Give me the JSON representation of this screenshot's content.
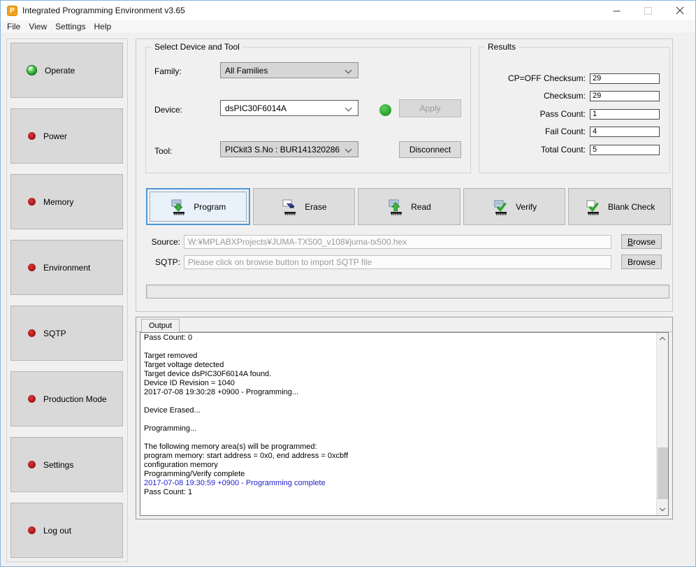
{
  "window": {
    "title": "Integrated Programming Environment v3.65"
  },
  "menu": {
    "items": [
      {
        "label": "File"
      },
      {
        "label": "View"
      },
      {
        "label": "Settings"
      },
      {
        "label": "Help"
      }
    ]
  },
  "sidebar": {
    "items": [
      {
        "label": "Operate",
        "status": "active"
      },
      {
        "label": "Power",
        "status": "inactive"
      },
      {
        "label": "Memory",
        "status": "inactive"
      },
      {
        "label": "Environment",
        "status": "inactive"
      },
      {
        "label": "SQTP",
        "status": "inactive"
      },
      {
        "label": "Production Mode",
        "status": "inactive"
      },
      {
        "label": "Settings",
        "status": "inactive"
      },
      {
        "label": "Log out",
        "status": "inactive"
      }
    ]
  },
  "device_tool": {
    "group_title": "Select Device and Tool",
    "family_label": "Family:",
    "family_value": "All Families",
    "device_label": "Device:",
    "device_value": "dsPIC30F6014A",
    "tool_label": "Tool:",
    "tool_value": "PICkit3 S.No : BUR141320286",
    "apply_label": "Apply",
    "disconnect_label": "Disconnect"
  },
  "results": {
    "group_title": "Results",
    "rows": [
      {
        "label": "CP=OFF Checksum:",
        "value": "29"
      },
      {
        "label": "Checksum:",
        "value": "29"
      },
      {
        "label": "Pass Count:",
        "value": "1"
      },
      {
        "label": "Fail Count:",
        "value": "4"
      },
      {
        "label": "Total Count:",
        "value": "5"
      }
    ]
  },
  "actions": {
    "buttons": [
      {
        "label": "Program",
        "icon": "program-icon",
        "selected": true
      },
      {
        "label": "Erase",
        "icon": "erase-icon",
        "selected": false
      },
      {
        "label": "Read",
        "icon": "read-icon",
        "selected": false
      },
      {
        "label": "Verify",
        "icon": "verify-icon",
        "selected": false
      },
      {
        "label": "Blank Check",
        "icon": "blank-check-icon",
        "selected": false
      }
    ]
  },
  "files": {
    "source_label": "Source:",
    "source_value": "W:¥MPLABXProjects¥JUMA-TX500_v108¥juma-tx500.hex",
    "sqtp_label": "SQTP:",
    "sqtp_placeholder": "Please click on browse button to import SQTP file",
    "browse_label": "Browse"
  },
  "output": {
    "tab_label": "Output",
    "lines": [
      {
        "text": "Pass Count: 0",
        "highlight": false
      },
      {
        "text": "",
        "highlight": false
      },
      {
        "text": "Target removed",
        "highlight": false
      },
      {
        "text": "Target voltage detected",
        "highlight": false
      },
      {
        "text": "Target device dsPIC30F6014A found.",
        "highlight": false
      },
      {
        "text": "Device ID Revision = 1040",
        "highlight": false
      },
      {
        "text": "2017-07-08 19:30:28 +0900 - Programming...",
        "highlight": false
      },
      {
        "text": "",
        "highlight": false
      },
      {
        "text": "Device Erased...",
        "highlight": false
      },
      {
        "text": "",
        "highlight": false
      },
      {
        "text": "Programming...",
        "highlight": false
      },
      {
        "text": "",
        "highlight": false
      },
      {
        "text": "The following memory area(s) will be programmed:",
        "highlight": false
      },
      {
        "text": "program memory: start address = 0x0, end address = 0xcbff",
        "highlight": false
      },
      {
        "text": "configuration memory",
        "highlight": false
      },
      {
        "text": "Programming/Verify complete",
        "highlight": false
      },
      {
        "text": "2017-07-08 19:30:59 +0900 - Programming complete",
        "highlight": true
      },
      {
        "text": "Pass Count: 1",
        "highlight": false
      }
    ]
  },
  "colors": {
    "window_border": "#86b7e2",
    "titlebar_bg": "#ffffff",
    "selected_button_border": "#4f96d2",
    "selected_button_bg": "#e9f2fb",
    "active_indicator": "#2fb53a",
    "inactive_indicator": "#a01010",
    "device_status_green": "#28a428",
    "log_highlight": "#2222cc"
  }
}
